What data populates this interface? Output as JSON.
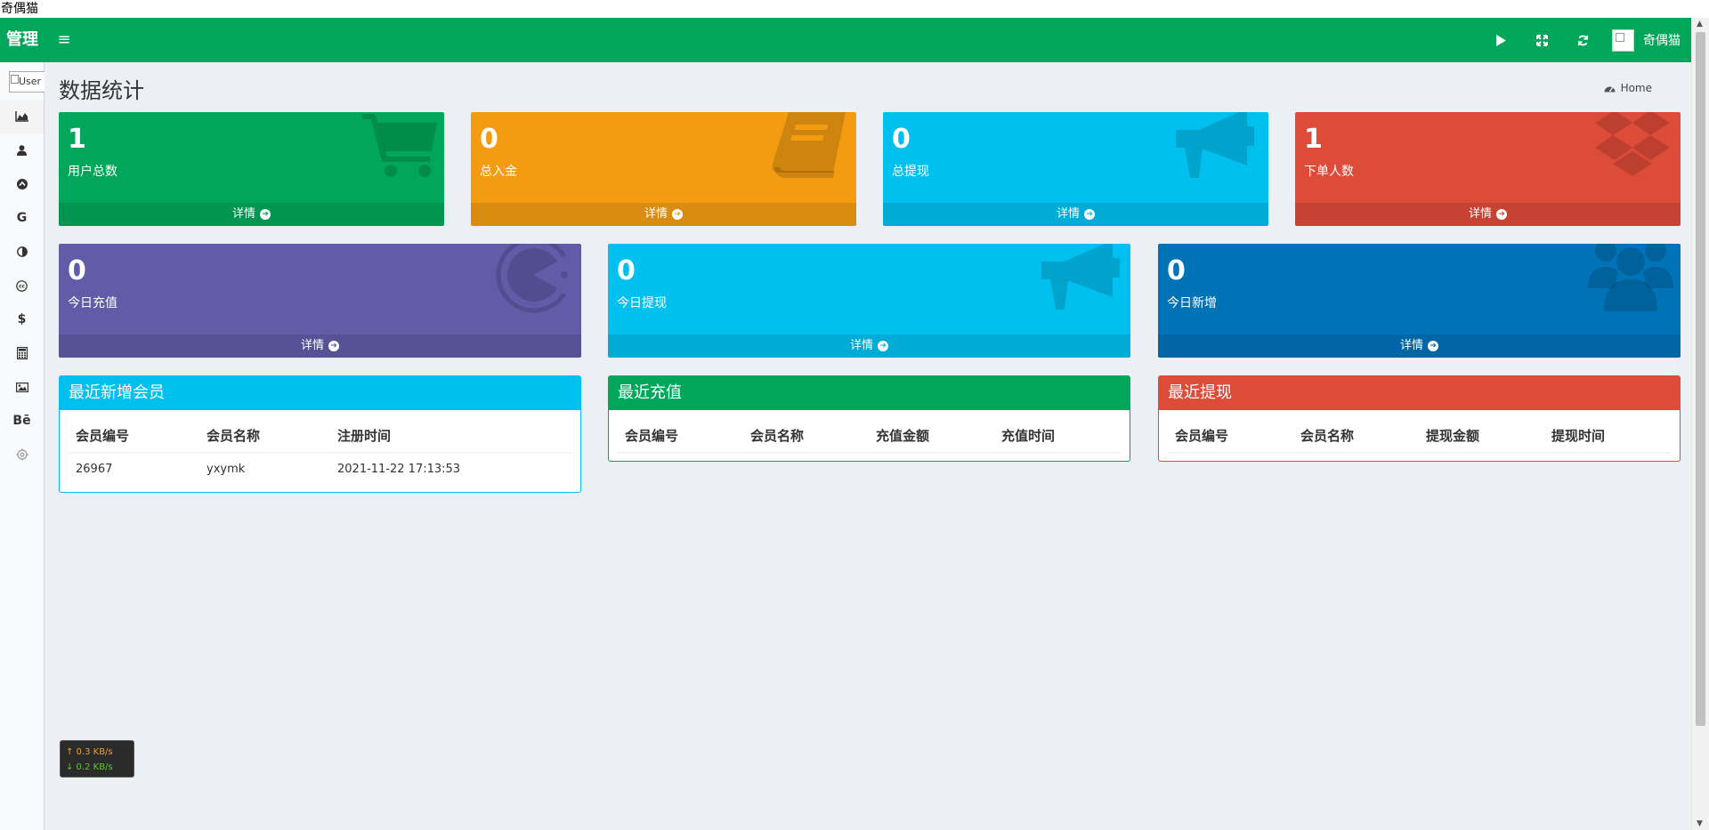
{
  "window_title": "奇偶猫",
  "header": {
    "logo": "管理",
    "user_name": "奇偶猫"
  },
  "sidebar": {
    "user_image_alt": "User"
  },
  "page": {
    "title": "数据统计",
    "breadcrumb": "Home"
  },
  "stats_row1": [
    {
      "value": "1",
      "label": "用户总数",
      "footer": "详情",
      "color": "#00a65a",
      "icon": "shopping-cart-icon"
    },
    {
      "value": "0",
      "label": "总入金",
      "footer": "详情",
      "color": "#f39c12",
      "icon": "book-icon"
    },
    {
      "value": "0",
      "label": "总提现",
      "footer": "详情",
      "color": "#00c0ef",
      "icon": "bullhorn-icon"
    },
    {
      "value": "1",
      "label": "下单人数",
      "footer": "详情",
      "color": "#dd4b39",
      "icon": "dropbox-icon"
    }
  ],
  "stats_row2": [
    {
      "value": "0",
      "label": "今日充值",
      "footer": "详情",
      "color": "#605ca8",
      "icon": "copyright-pacman-icon"
    },
    {
      "value": "0",
      "label": "今日提现",
      "footer": "详情",
      "color": "#00c0ef",
      "icon": "bullhorn-icon"
    },
    {
      "value": "0",
      "label": "今日新增",
      "footer": "详情",
      "color": "#0073b7",
      "icon": "users-icon"
    }
  ],
  "panels": {
    "new_members": {
      "title": "最近新增会员",
      "columns": [
        "会员编号",
        "会员名称",
        "注册时间"
      ],
      "rows": [
        [
          "26967",
          "yxymk",
          "2021-11-22 17:13:53"
        ]
      ]
    },
    "recharges": {
      "title": "最近充值",
      "columns": [
        "会员编号",
        "会员名称",
        "充值金额",
        "充值时间"
      ]
    },
    "withdrawals": {
      "title": "最近提现",
      "columns": [
        "会员编号",
        "会员名称",
        "提现金额",
        "提现时间"
      ]
    }
  },
  "netspeed": {
    "up": "↑ 0.3 KB/s",
    "down": "↓ 0.2 KB/s"
  }
}
